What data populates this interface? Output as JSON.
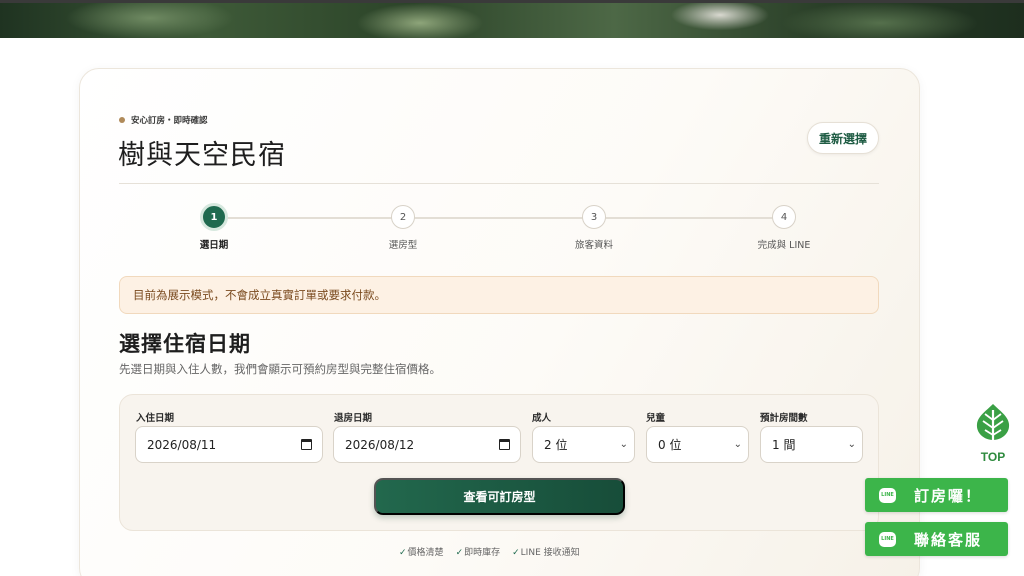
{
  "tagline": "安心訂房・即時確認",
  "site_title": "樹與天空民宿",
  "reset_label": "重新選擇",
  "steps": [
    {
      "num": "1",
      "label": "選日期"
    },
    {
      "num": "2",
      "label": "選房型"
    },
    {
      "num": "3",
      "label": "旅客資料"
    },
    {
      "num": "4",
      "label": "完成與 LINE"
    }
  ],
  "notice": "目前為展示模式，不會成立真實訂單或要求付款。",
  "section": {
    "title": "選擇住宿日期",
    "desc": "先選日期與入住人數，我們會顯示可預約房型與完整住宿價格。"
  },
  "form": {
    "checkin_label": "入住日期",
    "checkin_value": "2026/08/11",
    "checkout_label": "退房日期",
    "checkout_value": "2026/08/12",
    "adults_label": "成人",
    "adults_value": "2 位",
    "children_label": "兒童",
    "children_value": "0 位",
    "rooms_label": "預計房間數",
    "rooms_value": "1 間",
    "submit_label": "查看可訂房型"
  },
  "features": [
    "價格清楚",
    "即時庫存",
    "LINE 接收通知"
  ],
  "top_label": "TOP",
  "line_buttons": {
    "book": "訂房囉！",
    "contact": "聯絡客服",
    "icon_text": "LINE"
  },
  "colors": {
    "brand_green": "#1f6a4f",
    "line_green": "#3cb54a",
    "notice_bg": "#fdf1e4"
  }
}
